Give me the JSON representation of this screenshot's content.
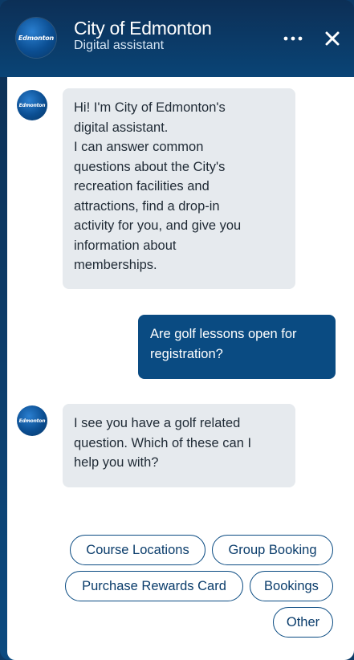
{
  "header": {
    "title": "City of Edmonton",
    "subtitle": "Digital assistant",
    "logo_text": "Edmonton",
    "more_icon": "more-horizontal-icon",
    "close_icon": "close-icon"
  },
  "messages": [
    {
      "from": "bot",
      "avatar_text": "Edmonton",
      "text": "Hi! I'm City of Edmonton's\ndigital assistant.\nI can answer common\nquestions about the City's\nrecreation facilities and\nattractions, find a drop-in\nactivity for you, and give you\ninformation about\nmemberships."
    },
    {
      "from": "user",
      "text": "Are golf lessons open for\nregistration?"
    },
    {
      "from": "bot",
      "avatar_text": "Edmonton",
      "text": "I see you have a golf related\nquestion. Which of these can I\nhelp you with?"
    }
  ],
  "quick_replies": [
    "Course Locations",
    "Group Booking",
    "Purchase Rewards Card",
    "Bookings",
    "Other"
  ],
  "colors": {
    "brand": "#0a4b82",
    "bot_bubble": "#e6eaee",
    "header_bg": "#0c2f56"
  }
}
